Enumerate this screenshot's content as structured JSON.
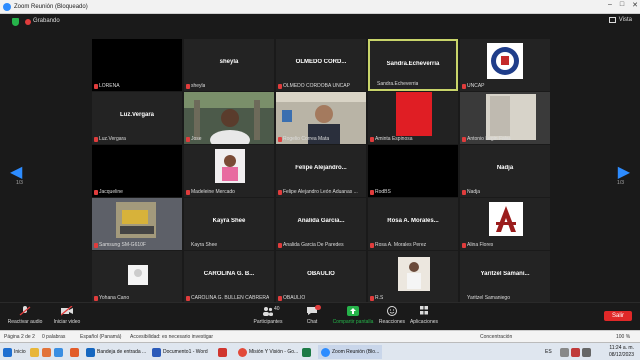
{
  "window": {
    "title": "Zoom Reunión (Bloqueado)",
    "controls": [
      "–",
      "□",
      "✕"
    ]
  },
  "meeting": {
    "recording_label": "Grabando",
    "view_label": "Vista",
    "page_left": "1/3",
    "page_right": "1/3"
  },
  "tiles": [
    {
      "label": "LORENA",
      "name": ""
    },
    {
      "label": "sheyla",
      "name": "sheyla"
    },
    {
      "label": "OLMEDO CORDOBA UNCAP",
      "name": "OLMEDO CORD..."
    },
    {
      "label": "Sandra.Echeverria",
      "name": "Sandra.Echeverria"
    },
    {
      "label": "UNCAP",
      "name": ""
    },
    {
      "label": "Luz.Vergara",
      "name": "Luz.Vergara"
    },
    {
      "label": "Jose",
      "name": ""
    },
    {
      "label": "Rogelio Correa Mata",
      "name": ""
    },
    {
      "label": "Aminta Espinosa",
      "name": ""
    },
    {
      "label": "Antonio Legin Falau",
      "name": ""
    },
    {
      "label": "Jacqueline",
      "name": ""
    },
    {
      "label": "Madeleine Mercado",
      "name": ""
    },
    {
      "label": "Felipe Alejandro León Aduanas ...",
      "name": "Felipe Alejandro..."
    },
    {
      "label": "RodBS",
      "name": ""
    },
    {
      "label": "Nadja",
      "name": "Nadja"
    },
    {
      "label": "Samsung SM-G610F",
      "name": ""
    },
    {
      "label": "Kayra Shee",
      "name": "Kayra Shee"
    },
    {
      "label": "Analida Garcia De Paredes",
      "name": "Analida Garcia..."
    },
    {
      "label": "Rosa A. Morales Perez",
      "name": "Rosa A. Morales..."
    },
    {
      "label": "Alina Flores",
      "name": ""
    },
    {
      "label": "Yohana Cano",
      "name": ""
    },
    {
      "label": "CAROLINA G. BULLEN CABRERA",
      "name": "CAROLINA G. B..."
    },
    {
      "label": "OBAULIO",
      "name": "OBAULIO"
    },
    {
      "label": "R.S",
      "name": ""
    },
    {
      "label": "Yaritzel Samaniego",
      "name": "Yaritzel Samani..."
    }
  ],
  "toolbar": {
    "audio": "Reactivar audio",
    "video": "Iniciar video",
    "participants": "Participantes",
    "participants_count": "40",
    "chat": "Chat",
    "share": "Compartir pantalla",
    "reactions": "Reacciones",
    "apps": "Aplicaciones",
    "leave": "Salir"
  },
  "statusbar": {
    "page": "Página 2 de 2",
    "words": "0 palabras",
    "language": "Español (Panamá)",
    "accessibility": "Accesibilidad: es necesario investigar",
    "focus": "Concentración",
    "zoom": "100 %"
  },
  "taskbar": {
    "start": "Inicio",
    "items": [
      "Bandeja de entrada ...",
      "Documento1 - Word",
      "Misión Y Visión - Go...",
      "Zoom Reunión (Blo..."
    ],
    "lang": "ES",
    "time": "11:24 a. m.",
    "date": "08/12/2023"
  },
  "colors": {
    "accent": "#2d8cff",
    "active_speaker": "#c8d46a",
    "leave": "#e02828",
    "recording": "#e03c3c"
  }
}
